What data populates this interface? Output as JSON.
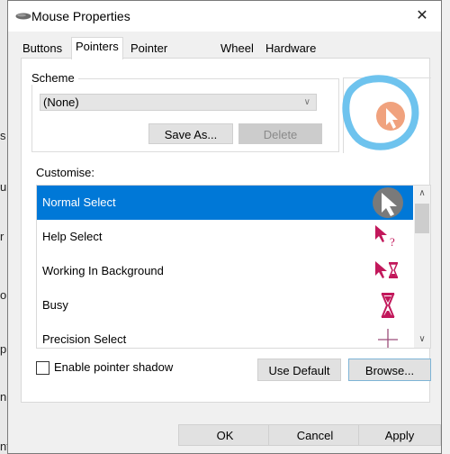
{
  "background": {
    "edge_letters": [
      "s",
      "u",
      "r",
      "o",
      "p",
      "n",
      "nt"
    ]
  },
  "window": {
    "title": "Mouse Properties",
    "close_glyph": "✕"
  },
  "tabs": [
    {
      "label": "Buttons",
      "active": false
    },
    {
      "label": "Pointers",
      "active": true
    },
    {
      "label": "Pointer Options",
      "active": false
    },
    {
      "label": "Wheel",
      "active": false
    },
    {
      "label": "Hardware",
      "active": false
    }
  ],
  "scheme": {
    "label": "Scheme",
    "selected": "(None)",
    "save_as_label": "Save As...",
    "delete_label": "Delete"
  },
  "customise": {
    "label": "Customise:",
    "items": [
      {
        "label": "Normal Select",
        "icon": "normal-select-cursor",
        "selected": true
      },
      {
        "label": "Help Select",
        "icon": "help-select-cursor",
        "selected": false
      },
      {
        "label": "Working In Background",
        "icon": "working-background-cursor",
        "selected": false
      },
      {
        "label": "Busy",
        "icon": "busy-hourglass-cursor",
        "selected": false
      },
      {
        "label": "Precision Select",
        "icon": "precision-crosshair-cursor",
        "selected": false
      }
    ]
  },
  "pointer_shadow": {
    "label": "Enable pointer shadow",
    "checked": false
  },
  "buttons": {
    "use_default": "Use Default",
    "browse": "Browse...",
    "ok": "OK",
    "cancel": "Cancel",
    "apply": "Apply"
  },
  "colors": {
    "selection": "#0078d7",
    "cursor_magenta": "#c2185b",
    "annotation_circle": "#6ec3ee",
    "preview_badge": "#f0a27e"
  }
}
